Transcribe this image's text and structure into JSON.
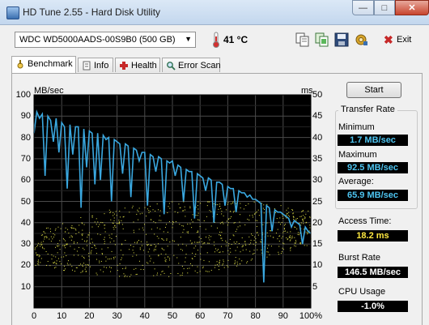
{
  "window": {
    "title": "HD Tune 2.55 - Hard Disk Utility",
    "buttons": {
      "minimize": "—",
      "maximize": "□",
      "close": "✕"
    }
  },
  "toolbar": {
    "drive": "WDC WD5000AADS-00S9B0 (500 GB)",
    "temperature": "41 °C",
    "exit_label": "Exit"
  },
  "tabs": [
    {
      "label": "Benchmark",
      "active": true
    },
    {
      "label": "Info",
      "active": false
    },
    {
      "label": "Health",
      "active": false
    },
    {
      "label": "Error Scan",
      "active": false
    }
  ],
  "actions": {
    "start_label": "Start"
  },
  "results": {
    "transfer_rate_title": "Transfer Rate",
    "minimum_label": "Minimum",
    "minimum_value": "1.7 MB/sec",
    "maximum_label": "Maximum",
    "maximum_value": "92.5 MB/sec",
    "average_label": "Average:",
    "average_value": "65.9 MB/sec",
    "access_time_label": "Access Time:",
    "access_time_value": "18.2 ms",
    "burst_rate_label": "Burst Rate",
    "burst_rate_value": "146.5 MB/sec",
    "cpu_usage_label": "CPU Usage",
    "cpu_usage_value": "-1.0%"
  },
  "chart_data": {
    "type": "line",
    "left_unit": "MB/sec",
    "right_unit": "ms",
    "ylim_left": [
      0,
      100
    ],
    "ylim_right": [
      0,
      50
    ],
    "xlim": [
      0,
      100
    ],
    "left_ticks": [
      "100",
      "90",
      "80",
      "70",
      "60",
      "50",
      "40",
      "30",
      "20",
      "10"
    ],
    "right_ticks": [
      "50",
      "45",
      "40",
      "35",
      "30",
      "25",
      "20",
      "15",
      "10",
      "5"
    ],
    "x_ticks": [
      "0",
      "10",
      "20",
      "30",
      "40",
      "50",
      "60",
      "70",
      "80",
      "90",
      "100%"
    ],
    "grid": true,
    "series": [
      {
        "role": "transfer_rate",
        "color": "#3aa8e0",
        "x": [
          0,
          1,
          2,
          3,
          4,
          5,
          6,
          7,
          8,
          9,
          10,
          11,
          12,
          13,
          14,
          15,
          16,
          17,
          18,
          19,
          20,
          21,
          22,
          23,
          24,
          25,
          26,
          27,
          28,
          29,
          30,
          31,
          32,
          33,
          34,
          35,
          36,
          37,
          38,
          39,
          40,
          41,
          42,
          43,
          44,
          45,
          46,
          47,
          48,
          49,
          50,
          51,
          52,
          53,
          54,
          55,
          56,
          57,
          58,
          59,
          60,
          61,
          62,
          63,
          64,
          65,
          66,
          67,
          68,
          69,
          70,
          71,
          72,
          73,
          74,
          75,
          76,
          77,
          78,
          79,
          80,
          81,
          82,
          83,
          84,
          85,
          86,
          87,
          88,
          89,
          90,
          91,
          92,
          93,
          94,
          95,
          96,
          97,
          98,
          99,
          100
        ],
        "y": [
          82,
          92,
          89,
          91,
          62,
          90,
          88,
          78,
          89,
          73,
          87,
          85,
          56,
          86,
          72,
          85,
          85,
          47,
          84,
          66,
          83,
          82,
          58,
          82,
          60,
          81,
          79,
          80,
          50,
          79,
          78,
          77,
          63,
          77,
          76,
          52,
          75,
          74,
          69,
          73,
          73,
          48,
          72,
          71,
          64,
          71,
          70,
          44,
          69,
          68,
          69,
          62,
          67,
          66,
          50,
          65,
          64,
          64,
          42,
          63,
          62,
          61,
          55,
          61,
          60,
          40,
          59,
          59,
          58,
          48,
          57,
          56,
          56,
          45,
          55,
          54,
          54,
          52,
          53,
          51,
          51,
          50,
          49,
          12,
          48,
          47,
          36,
          46,
          45,
          45,
          44,
          43,
          42,
          38,
          41,
          40,
          39,
          30,
          38,
          36,
          35
        ]
      }
    ],
    "access_time_scatter": {
      "color": "#e8e84a",
      "y_range_ms": [
        5,
        25
      ],
      "count": 900
    }
  }
}
